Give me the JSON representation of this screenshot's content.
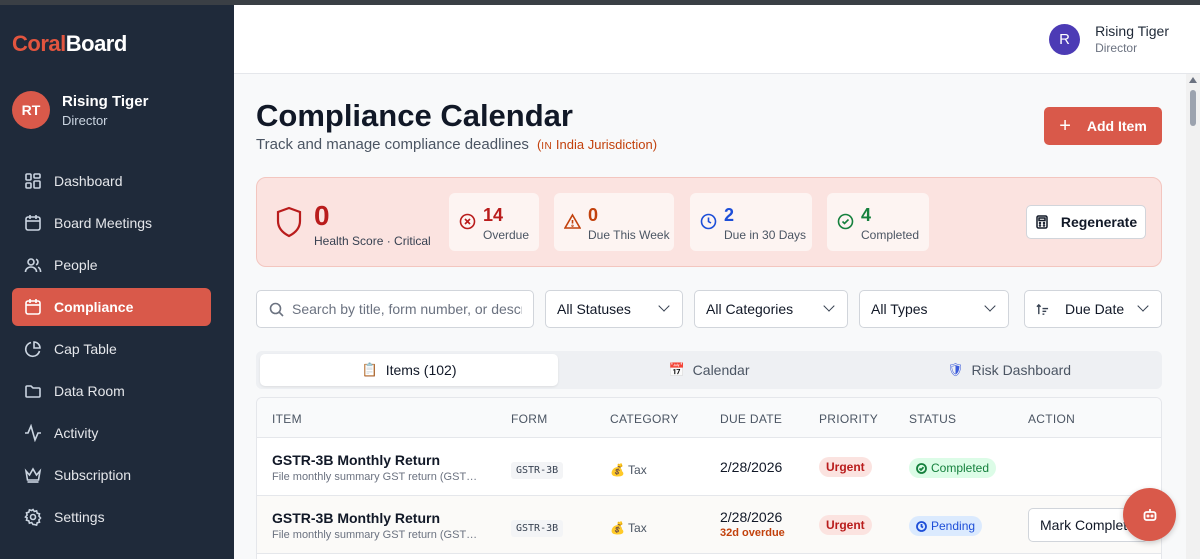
{
  "brand": {
    "part1": "Coral",
    "part2": "Board"
  },
  "sidebar_user": {
    "initials": "RT",
    "name": "Rising Tiger",
    "role": "Director"
  },
  "nav": [
    {
      "label": "Dashboard",
      "icon": "grid-icon"
    },
    {
      "label": "Board Meetings",
      "icon": "calendar-icon"
    },
    {
      "label": "People",
      "icon": "users-icon"
    },
    {
      "label": "Compliance",
      "icon": "calendar-icon",
      "active": true
    },
    {
      "label": "Cap Table",
      "icon": "pie-chart-icon"
    },
    {
      "label": "Data Room",
      "icon": "folder-icon"
    },
    {
      "label": "Activity",
      "icon": "activity-icon"
    },
    {
      "label": "Subscription",
      "icon": "crown-icon"
    },
    {
      "label": "Settings",
      "icon": "gear-icon"
    }
  ],
  "header_user": {
    "initial": "R",
    "name": "Rising Tiger",
    "role": "Director"
  },
  "page": {
    "title": "Compliance Calendar",
    "subtitle": "Track and manage compliance deadlines",
    "jurisdiction_code": "IN",
    "jurisdiction": "India Jurisdiction",
    "add_label": "Add Item"
  },
  "health": {
    "score": "0",
    "label": "Health Score · Critical",
    "stats": [
      {
        "value": "14",
        "label": "Overdue",
        "color": "#b91c1c"
      },
      {
        "value": "0",
        "label": "Due This Week",
        "color": "#c2410c"
      },
      {
        "value": "2",
        "label": "Due in 30 Days",
        "color": "#1d4ed8"
      },
      {
        "value": "4",
        "label": "Completed",
        "color": "#15803d"
      }
    ],
    "regenerate_label": "Regenerate"
  },
  "filters": {
    "search_placeholder": "Search by title, form number, or description",
    "status": "All Statuses",
    "category": "All Categories",
    "type": "All Types",
    "sort": "Due Date"
  },
  "tabs": [
    {
      "label": "Items (102)",
      "icon": "📋"
    },
    {
      "label": "Calendar",
      "icon": "📅"
    },
    {
      "label": "Risk Dashboard",
      "icon": "🛡"
    }
  ],
  "table": {
    "headers": [
      "ITEM",
      "FORM",
      "CATEGORY",
      "DUE DATE",
      "PRIORITY",
      "STATUS",
      "ACTION"
    ],
    "rows": [
      {
        "title": "GSTR-3B Monthly Return",
        "desc": "File monthly summary GST return (GST…",
        "form": "GSTR-3B",
        "category": "💰 Tax",
        "due": "2/28/2026",
        "overdue": "",
        "priority": "Urgent",
        "status": "Completed",
        "action": ""
      },
      {
        "title": "GSTR-3B Monthly Return",
        "desc": "File monthly summary GST return (GST…",
        "form": "GSTR-3B",
        "category": "💰 Tax",
        "due": "2/28/2026",
        "overdue": "32d overdue",
        "priority": "Urgent",
        "status": "Pending",
        "action": "Mark Complete"
      }
    ]
  },
  "colors": {
    "accent": "#d9594a",
    "sidebar_bg": "#1f2a3a"
  }
}
